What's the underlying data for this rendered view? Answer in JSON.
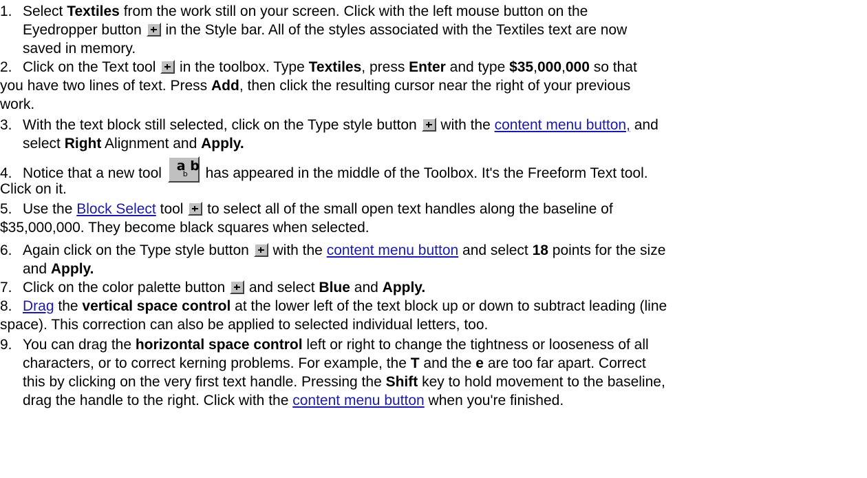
{
  "icons": {
    "eyedropper": "eyedropper-icon",
    "text_tool": "text-tool-icon",
    "type_style": "type-style-icon",
    "freeform_text": "freeform-text-tool-icon",
    "block_select": "block-select-icon",
    "color_palette": "color-palette-icon"
  },
  "freeform_glyph_top": "a b",
  "freeform_glyph_bottom": "b",
  "s1": {
    "num": "1.",
    "t1": "Select ",
    "b1": "Textiles",
    "t2": " from the work still on your screen.   Click with the left mouse button on the",
    "t3": "Eyedropper button ",
    "t4": " in the Style bar.   All of the styles associated with the Textiles text are now",
    "t5": "saved in memory."
  },
  "s2": {
    "num": "2.",
    "t1": "Click on the Text tool ",
    "t2": " in the toolbox.   Type ",
    "b1": "Textiles",
    "t3": ", press ",
    "b2": "Enter",
    "t4": " and type ",
    "b3": "$35",
    "t5": ",",
    "b4": "000",
    "t6": ",",
    "b5": "000",
    "t7": " so that",
    "t8": "you have two lines of text.   Press ",
    "b6": "Add",
    "t9": ", then click the resulting cursor near the right of your previous",
    "t10": "work."
  },
  "s3": {
    "num": "3.",
    "t1": "With the text block still selected, click on the Type style button ",
    "t2": " with the ",
    "link": "content menu button,",
    "t3": " and",
    "t4": "select ",
    "b1": "Right",
    "t5": " Alignment and ",
    "b2": "Apply."
  },
  "s4": {
    "num": "4.",
    "t1": "Notice that a new tool ",
    "t2": " has appeared in the middle of the Toolbox.   It's the Freeform Text tool.",
    "t3": "Click on it."
  },
  "s5": {
    "num": "5.",
    "t1": "Use the ",
    "link": "Block Select",
    "t2": " tool ",
    "t3": " to select all of the small open text handles along the baseline of",
    "t4": "$35,000,000.   They become black squares when selected."
  },
  "s6": {
    "num": "6.",
    "t1": "Again click on the Type style button ",
    "t2": " with the ",
    "link": "content menu button",
    "t3": " and select ",
    "b1": "18",
    "t4": " points for the size",
    "t5": "and ",
    "b2": "Apply."
  },
  "s7": {
    "num": "7.",
    "t1": "Click on the color palette button ",
    "t2": " and select ",
    "b1": "Blue",
    "t3": " and ",
    "b2": "Apply."
  },
  "s8": {
    "num": "8.",
    "link": "Drag",
    "t1": " the ",
    "b1": "vertical space control",
    "t2": " at the lower left of the text block up or down to subtract leading (line",
    "t3": "space).   This correction can also be applied to selected individual letters, too."
  },
  "s9": {
    "num": "9.",
    "t1": "You can drag the ",
    "b1": "horizontal space control",
    "t2": " left or right to change the tightness or looseness of all",
    "t3": "characters, or to correct kerning problems.   For example, the ",
    "b2": "T",
    "t4": " and the ",
    "b3": "e",
    "t5": " are too far apart.   Correct",
    "t6": "this by clicking on the very first text handle.   Pressing the ",
    "b4": "Shift",
    "t7": " key to hold movement to the baseline,",
    "t8": "drag the handle to the right.   Click with the ",
    "link": "content menu button",
    "t9": " when you're finished."
  }
}
